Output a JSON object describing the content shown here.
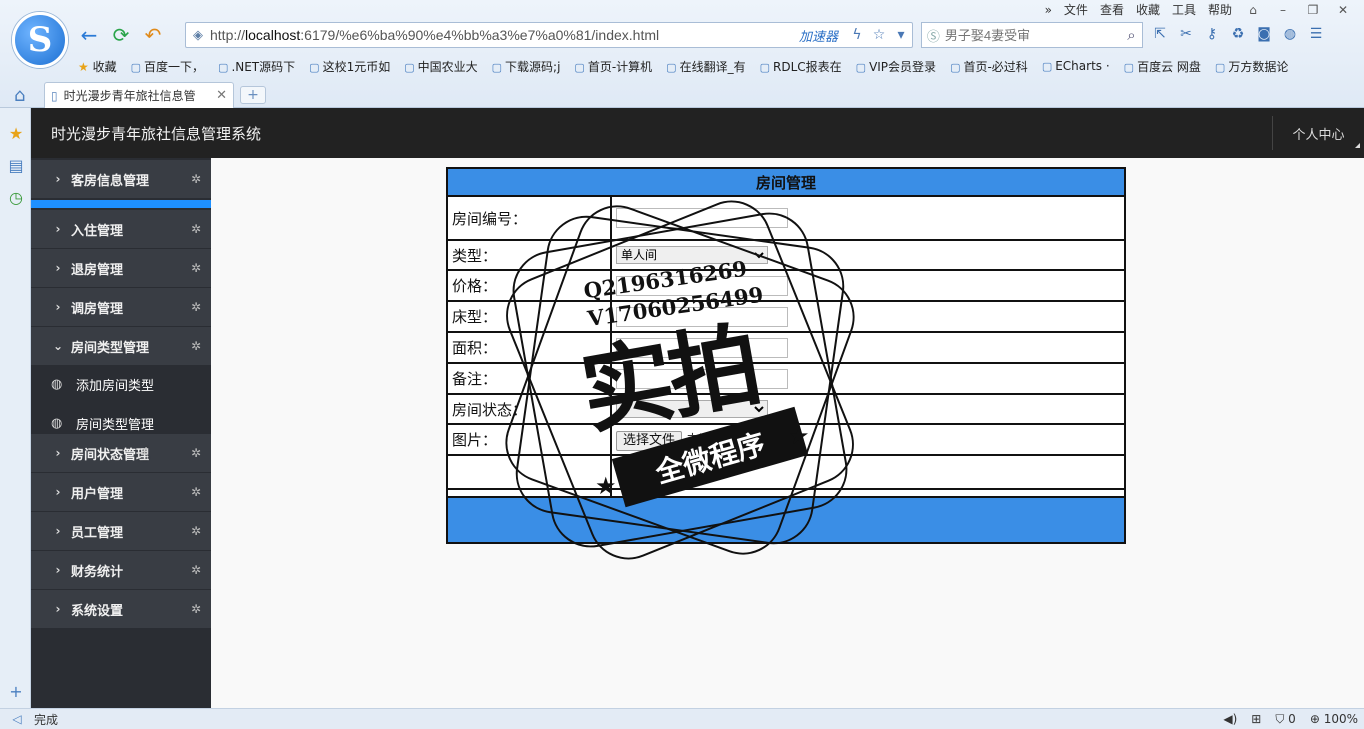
{
  "browser": {
    "url_prefix": "http://",
    "url_host": "localhost",
    "url_rest": ":6179/%e6%ba%90%e4%bb%a3%e7%a0%81/index.html",
    "accelerator_label": "加速器",
    "search_placeholder": "男子娶4妻受审",
    "menu": [
      "文件",
      "查看",
      "收藏",
      "工具",
      "帮助"
    ],
    "bookmarks": [
      "收藏",
      "百度一下，",
      ".NET源码下",
      "这校1元币如",
      "中国农业大",
      "下载源码;j",
      "首页-计算机",
      "在线翻译_有",
      "RDLC报表在",
      "VIP会员登录",
      "首页-必过科",
      "ECharts ·",
      "百度云 网盘",
      "万方数据论"
    ],
    "tab_title": "时光漫步青年旅社信息管",
    "status_text": "完成",
    "status_count": "0",
    "zoom": "100%"
  },
  "app": {
    "title": "时光漫步青年旅社信息管理系统",
    "user_center": "个人中心"
  },
  "sidebar": {
    "items": [
      {
        "label": "客房信息管理"
      },
      {
        "label": "入住管理"
      },
      {
        "label": "退房管理"
      },
      {
        "label": "调房管理"
      },
      {
        "label": "房间类型管理"
      },
      {
        "label": "房间状态管理"
      },
      {
        "label": "用户管理"
      },
      {
        "label": "员工管理"
      },
      {
        "label": "财务统计"
      },
      {
        "label": "系统设置"
      }
    ],
    "subitems": [
      {
        "label": "添加房间类型"
      },
      {
        "label": "房间类型管理"
      }
    ]
  },
  "form": {
    "heading": "房间管理",
    "labels": {
      "room_no": "房间编号：",
      "type": "类型：",
      "price": "价格：",
      "bed": "床型：",
      "area": "面积：",
      "remark": "备注：",
      "status": "房间状态：",
      "image": "图片："
    },
    "type_selected": "单人间",
    "file_button": "选择文件",
    "file_none": "未选择文件"
  },
  "watermark": {
    "line1": "Q2196316269",
    "line2": "V17060256499",
    "big": "实拍",
    "banner": "全微程序"
  }
}
